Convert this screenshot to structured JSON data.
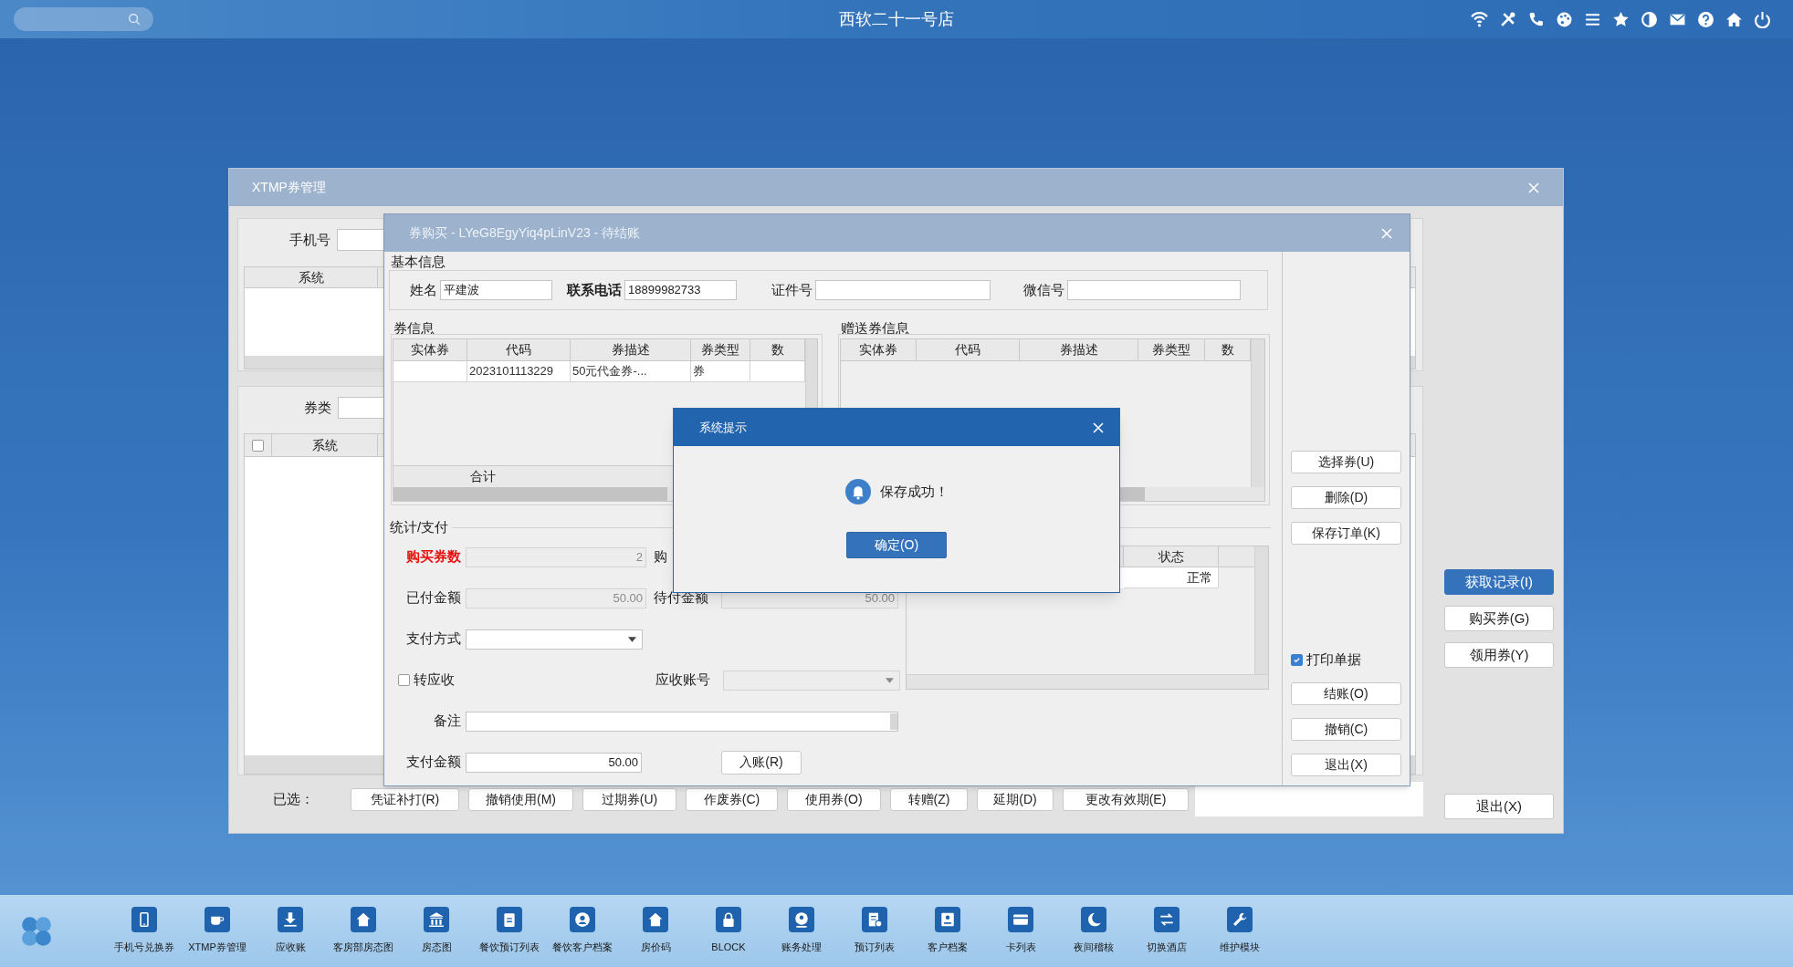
{
  "top_bar": {
    "title": "西软二十一号店"
  },
  "manager_window": {
    "title": "XTMP券管理",
    "phone_label": "手机号",
    "upper_table": {
      "columns": [
        "系统"
      ]
    },
    "type_label": "券类",
    "lower_table": {
      "select_all_checked": false,
      "columns": [
        "系统"
      ]
    },
    "selected_label": "已选：",
    "action_buttons": [
      "凭证补打(R)",
      "撤销使用(M)",
      "过期券(U)",
      "作废券(C)",
      "使用券(O)",
      "转赠(Z)",
      "延期(D)",
      "更改有效期(E)"
    ],
    "side_buttons": [
      {
        "label": "获取记录(I)",
        "default": true
      },
      {
        "label": "购买券(G)",
        "default": false
      },
      {
        "label": "领用券(Y)",
        "default": false
      }
    ],
    "exit_button": "退出(X)"
  },
  "purchase_window": {
    "title": "券购买 - LYeG8EgyYiq4pLinV23 - 待结账",
    "basic_info": {
      "title": "基本信息",
      "fields": [
        {
          "label": "姓名",
          "value": "平建波",
          "bold": false
        },
        {
          "label": "联系电话",
          "value": "18899982733",
          "bold": true
        },
        {
          "label": "证件号",
          "bold": false
        },
        {
          "label": "微信号",
          "bold": false
        }
      ]
    },
    "coupon_info": {
      "title": "券信息",
      "columns": [
        "实体券",
        "代码",
        "券描述",
        "券类型",
        "数"
      ],
      "rows": [
        [
          "",
          "2023101113229",
          "50元代金券-...",
          "券",
          ""
        ]
      ],
      "footer_label": "合计"
    },
    "gift_info": {
      "title": "赠送券信息",
      "columns": [
        "实体券",
        "代码",
        "券描述",
        "券类型",
        "数"
      ]
    },
    "payment": {
      "title": "统计/支付",
      "count_label": "购买券数",
      "count_value": "2",
      "amount_label": "购",
      "paid_label": "已付金额",
      "paid_value": "50.00",
      "pending_label": "待付金额",
      "pending_value": "50.00",
      "method_label": "支付方式",
      "transfer": {
        "label": "转应收",
        "checked": false
      },
      "account_label": "应收账号",
      "remark_label": "备注",
      "pay_label": "支付金额",
      "pay_value": "50.00",
      "post_button": "入账(R)"
    },
    "status_table": {
      "columns": [
        "状态"
      ],
      "rows": [
        [
          "正常"
        ]
      ]
    },
    "side_buttons_top": [
      "选择券(U)",
      "删除(D)",
      "保存订单(K)"
    ],
    "print_receipt": {
      "label": "打印单据",
      "checked": true
    },
    "side_buttons_bottom": [
      "结账(O)",
      "撤销(C)",
      "退出(X)"
    ]
  },
  "dialog": {
    "title": "系统提示",
    "message": "保存成功！",
    "ok_button": "确定(O)"
  },
  "taskbar": [
    {
      "label": "手机号兑换券"
    },
    {
      "label": "XTMP券管理"
    },
    {
      "label": "应收账"
    },
    {
      "label": "客房部房态图"
    },
    {
      "label": "房态图"
    },
    {
      "label": "餐饮预订列表"
    },
    {
      "label": "餐饮客户档案"
    },
    {
      "label": "房价码"
    },
    {
      "label": "BLOCK"
    },
    {
      "label": "账务处理"
    },
    {
      "label": "预订列表"
    },
    {
      "label": "客户档案"
    },
    {
      "label": "卡列表"
    },
    {
      "label": "夜间稽核"
    },
    {
      "label": "切换酒店"
    },
    {
      "label": "维护模块"
    }
  ]
}
